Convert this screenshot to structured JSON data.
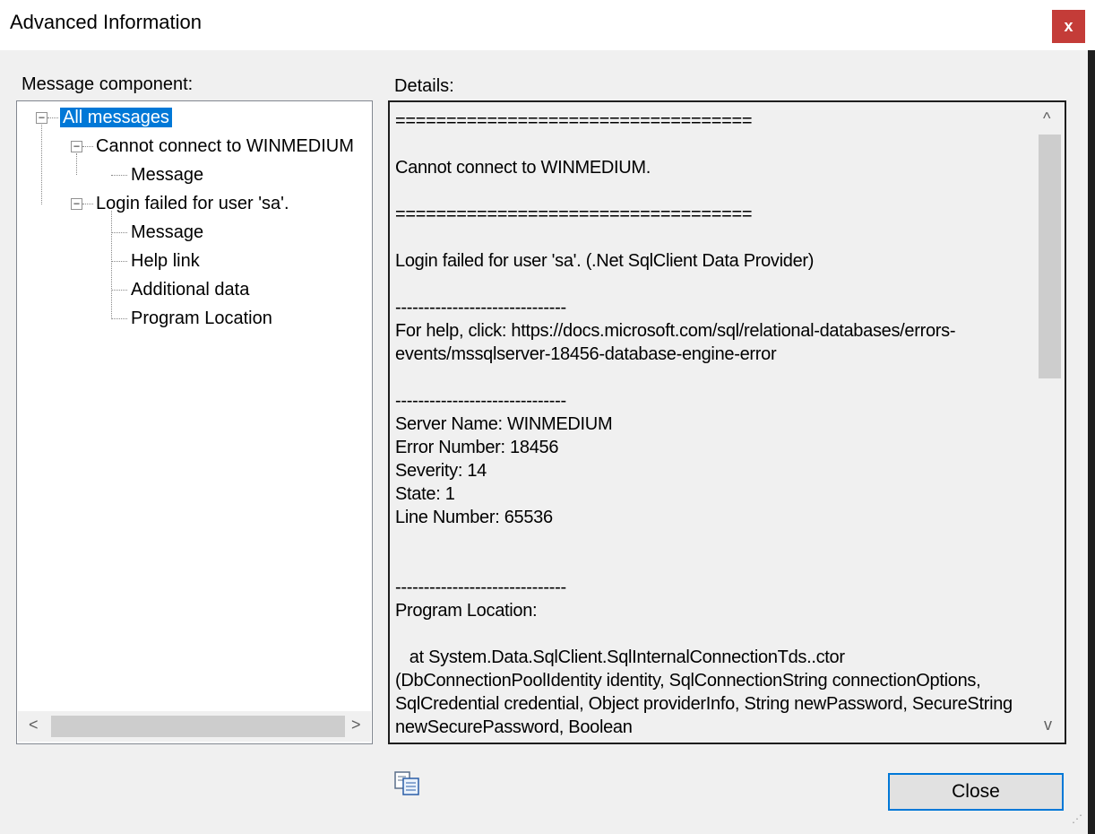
{
  "window": {
    "title": "Advanced Information",
    "close_glyph": "x"
  },
  "left_panel": {
    "label": "Message component:",
    "tree": {
      "root": "All messages",
      "nodes": [
        {
          "label": "Cannot connect to WINMEDIUM",
          "children": [
            "Message"
          ]
        },
        {
          "label": "Login failed for user 'sa'.",
          "children": [
            "Message",
            "Help link",
            "Additional data",
            "Program Location"
          ]
        }
      ]
    },
    "hscroll": {
      "left_arrow": "<",
      "right_arrow": ">"
    }
  },
  "right_panel": {
    "label": "Details:",
    "text": "===================================\n\nCannot connect to WINMEDIUM.\n\n===================================\n\nLogin failed for user 'sa'. (.Net SqlClient Data Provider)\n\n------------------------------\nFor help, click: https://docs.microsoft.com/sql/relational-databases/errors-events/mssqlserver-18456-database-engine-error\n\n------------------------------\nServer Name: WINMEDIUM\nError Number: 18456\nSeverity: 14\nState: 1\nLine Number: 65536\n\n\n------------------------------\nProgram Location:\n\n   at System.Data.SqlClient.SqlInternalConnectionTds..ctor (DbConnectionPoolIdentity identity, SqlConnectionString connectionOptions, SqlCredential credential, Object providerInfo, String newPassword, SecureString newSecurePassword, Boolean",
    "vscroll": {
      "up_arrow": "^",
      "down_arrow": "v"
    }
  },
  "footer": {
    "copy_icon": "copy-icon",
    "close_label": "Close"
  },
  "colors": {
    "selection": "#0078d7",
    "close_titlebar": "#c43c38",
    "background": "#f0f0f0"
  }
}
